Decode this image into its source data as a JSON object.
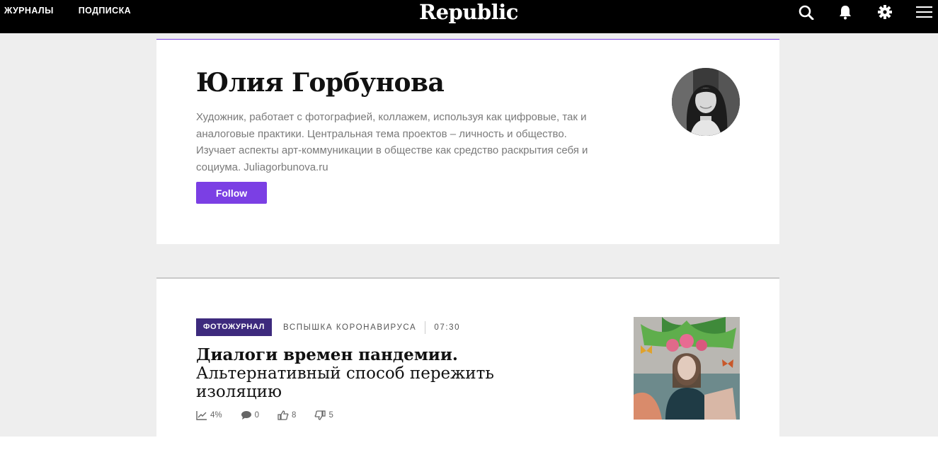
{
  "topbar": {
    "nav": [
      "ЖУРНАЛЫ",
      "ПОДПИСКА"
    ],
    "logo": "Republic",
    "icons": [
      "search-icon",
      "bell-icon",
      "gear-icon",
      "menu-icon"
    ]
  },
  "profile": {
    "name": "Юлия Горбунова",
    "bio": "Художник, работает с фотографией, коллажем, используя как цифровые, так и аналоговые практики. Центральная тема проектов – личность и общество. Изучает аспекты арт-коммуникации в обществе как средство раскрытия себя и социума. Juliagorbunova.ru",
    "follow_label": "Follow",
    "accent_color": "#7b3fe4"
  },
  "article": {
    "tag": "ФОТОЖУРНАЛ",
    "rubric": "ВСПЫШКА КОРОНАВИРУСА",
    "time": "07:30",
    "title_bold": "Диалоги времен пандемии.",
    "title_rest": "Альтернативный способ пережить изоляцию",
    "stats": {
      "views": "4%",
      "comments": "0",
      "likes": "8",
      "dislikes": "5"
    },
    "tag_color": "#3d2a7d"
  }
}
